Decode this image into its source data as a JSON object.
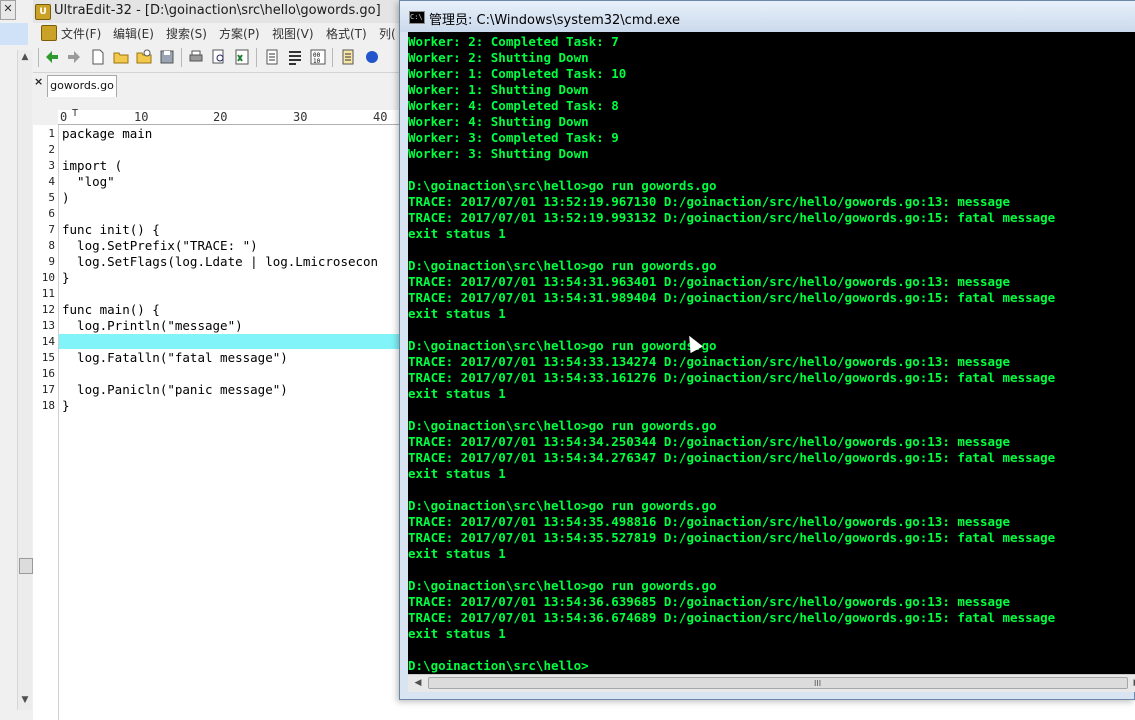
{
  "left_strip": {
    "close_glyph": "✕"
  },
  "ultraedit": {
    "title": "UltraEdit-32 - [D:\\goinaction\\src\\hello\\gowords.go]",
    "menu": [
      "文件(F)",
      "编辑(E)",
      "搜索(S)",
      "方案(P)",
      "视图(V)",
      "格式(T)",
      "列("
    ],
    "tab_label": "gowords.go",
    "ruler_labels": [
      "0",
      "10",
      "20",
      "30",
      "40"
    ],
    "line_numbers": [
      "1",
      "2",
      "3",
      "4",
      "5",
      "6",
      "7",
      "8",
      "9",
      "10",
      "11",
      "12",
      "13",
      "14",
      "15",
      "16",
      "17",
      "18"
    ],
    "code_lines": [
      "package main",
      "",
      "import (",
      "  \"log\"",
      ")",
      "",
      "func init() {",
      "  log.SetPrefix(\"TRACE: \")",
      "  log.SetFlags(log.Ldate | log.Lmicrosecon",
      "}",
      "",
      "func main() {",
      "  log.Println(\"message\")",
      "",
      "  log.Fatalln(\"fatal message\")",
      "",
      "  log.Panicln(\"panic message\")",
      "}"
    ],
    "highlight_color": "#80f4f8"
  },
  "cmd": {
    "title": "管理员: C:\\Windows\\system32\\cmd.exe",
    "icon_text": "C:\\",
    "text_color": "#00ff40",
    "lines": [
      "Worker: 2: Completed Task: 7",
      "Worker: 2: Shutting Down",
      "Worker: 1: Completed Task: 10",
      "Worker: 1: Shutting Down",
      "Worker: 4: Completed Task: 8",
      "Worker: 4: Shutting Down",
      "Worker: 3: Completed Task: 9",
      "Worker: 3: Shutting Down",
      "",
      "D:\\goinaction\\src\\hello>go run gowords.go",
      "TRACE: 2017/07/01 13:52:19.967130 D:/goinaction/src/hello/gowords.go:13: message",
      "TRACE: 2017/07/01 13:52:19.993132 D:/goinaction/src/hello/gowords.go:15: fatal message",
      "exit status 1",
      "",
      "D:\\goinaction\\src\\hello>go run gowords.go",
      "TRACE: 2017/07/01 13:54:31.963401 D:/goinaction/src/hello/gowords.go:13: message",
      "TRACE: 2017/07/01 13:54:31.989404 D:/goinaction/src/hello/gowords.go:15: fatal message",
      "exit status 1",
      "",
      "D:\\goinaction\\src\\hello>go run gowords.go",
      "TRACE: 2017/07/01 13:54:33.134274 D:/goinaction/src/hello/gowords.go:13: message",
      "TRACE: 2017/07/01 13:54:33.161276 D:/goinaction/src/hello/gowords.go:15: fatal message",
      "exit status 1",
      "",
      "D:\\goinaction\\src\\hello>go run gowords.go",
      "TRACE: 2017/07/01 13:54:34.250344 D:/goinaction/src/hello/gowords.go:13: message",
      "TRACE: 2017/07/01 13:54:34.276347 D:/goinaction/src/hello/gowords.go:15: fatal message",
      "exit status 1",
      "",
      "D:\\goinaction\\src\\hello>go run gowords.go",
      "TRACE: 2017/07/01 13:54:35.498816 D:/goinaction/src/hello/gowords.go:13: message",
      "TRACE: 2017/07/01 13:54:35.527819 D:/goinaction/src/hello/gowords.go:15: fatal message",
      "exit status 1",
      "",
      "D:\\goinaction\\src\\hello>go run gowords.go",
      "TRACE: 2017/07/01 13:54:36.639685 D:/goinaction/src/hello/gowords.go:13: message",
      "TRACE: 2017/07/01 13:54:36.674689 D:/goinaction/src/hello/gowords.go:15: fatal message",
      "exit status 1",
      "",
      "D:\\goinaction\\src\\hello>"
    ],
    "scroll_grip": "III"
  }
}
